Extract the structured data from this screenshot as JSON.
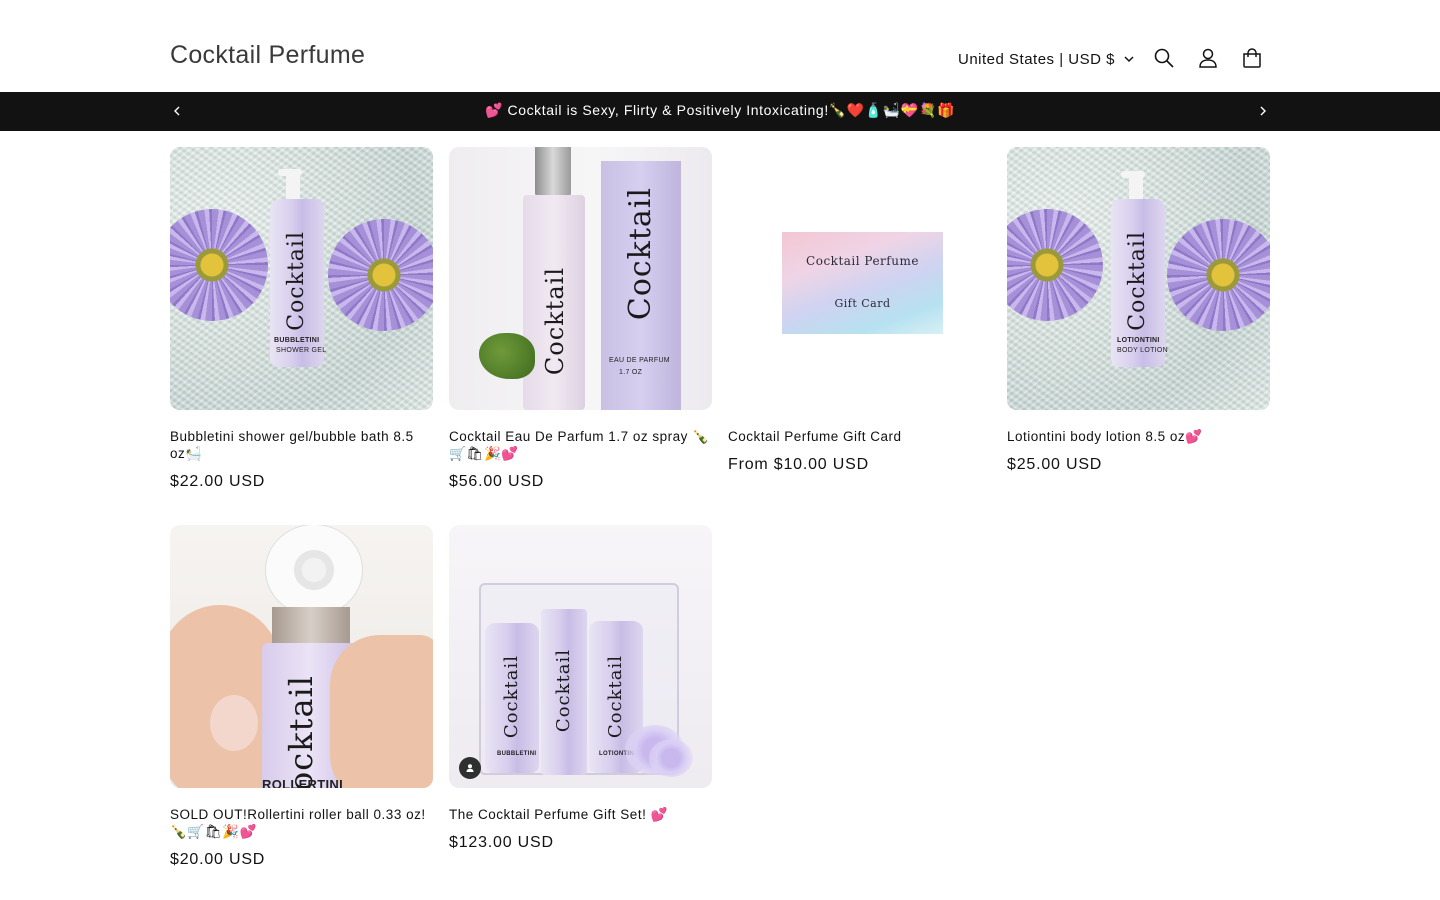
{
  "header": {
    "brand": "Cocktail Perfume",
    "country_selector": "United States | USD $",
    "icons": [
      "search-icon",
      "account-icon",
      "cart-icon"
    ]
  },
  "announcement": {
    "text": "💕 Cocktail is Sexy, Flirty & Positively Intoxicating!🍾❤️🧴🛀💝💐🎁"
  },
  "products": [
    {
      "title": "Bubbletini shower gel/bubble bath 8.5 oz🛀",
      "price": "$22.00 USD",
      "image": {
        "bottle_label": "BUBBLETINI",
        "bottle_sub": "SHOWER GEL"
      }
    },
    {
      "title": "Cocktail Eau De Parfum 1.7 oz spray 🍾🛒🛍🎉💕",
      "price": "$56.00 USD",
      "image": {
        "bottle_label": "EAU DE PARFUM",
        "bottle_sub": "1.7 OZ"
      }
    },
    {
      "title": "Cocktail Perfume Gift Card",
      "price": "From $10.00 USD",
      "image": {
        "line1": "Cocktail Perfume",
        "line2": "Gift Card"
      }
    },
    {
      "title": "Lotiontini body lotion 8.5 oz💕",
      "price": "$25.00 USD",
      "image": {
        "bottle_label": "LOTIONTINI",
        "bottle_sub": "BODY LOTION"
      }
    },
    {
      "title": "SOLD OUT!Rollertini roller ball 0.33 oz!🍾🛒🛍🎉💕",
      "price": "$20.00 USD",
      "image": {
        "bottle_label": "ROLLERTINI"
      }
    },
    {
      "title": "The Cocktail Perfume Gift Set! 💕",
      "price": "$123.00 USD",
      "image": {
        "bottle_label": "BUBBLETINI",
        "bottle_label_2": "LOTIONTINI"
      }
    }
  ],
  "logo_script": "Cocktail",
  "colors": {
    "announcement_bg": "#121212",
    "text": "#121212",
    "brand": "#3a3a3a"
  }
}
